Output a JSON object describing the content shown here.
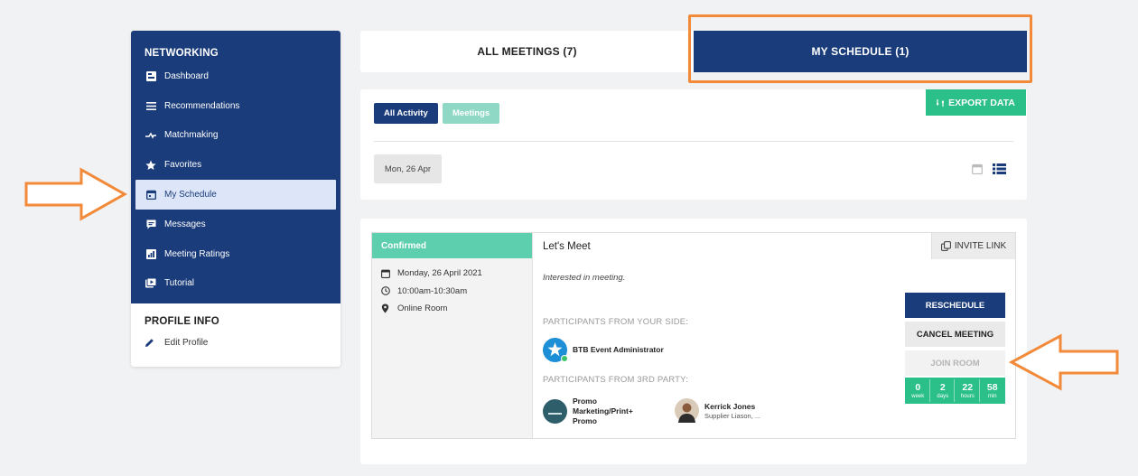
{
  "sidebar": {
    "title": "NETWORKING",
    "items": [
      {
        "label": "Dashboard",
        "icon": "dashboard-icon"
      },
      {
        "label": "Recommendations",
        "icon": "list-icon"
      },
      {
        "label": "Matchmaking",
        "icon": "handshake-icon"
      },
      {
        "label": "Favorites",
        "icon": "star-icon"
      },
      {
        "label": "My Schedule",
        "icon": "calendar-icon",
        "active": true
      },
      {
        "label": "Messages",
        "icon": "message-icon"
      },
      {
        "label": "Meeting Ratings",
        "icon": "rating-icon"
      },
      {
        "label": "Tutorial",
        "icon": "video-icon"
      }
    ],
    "profile_title": "PROFILE INFO",
    "edit_profile": "Edit Profile"
  },
  "tabs": {
    "all": "ALL MEETINGS (7)",
    "mine": "MY SCHEDULE (1)"
  },
  "filters": {
    "all_activity": "All Activity",
    "meetings": "Meetings",
    "export": "EXPORT DATA",
    "date": "Mon, 26 Apr"
  },
  "meeting": {
    "status": "Confirmed",
    "date": "Monday, 26 April 2021",
    "time": "10:00am-10:30am",
    "location": "Online Room",
    "title": "Let's Meet",
    "invite": "INVITE LINK",
    "description": "Interested in meeting.",
    "your_side_label": "PARTICIPANTS FROM YOUR SIDE:",
    "third_party_label": "PARTICIPANTS FROM 3RD PARTY:",
    "admin_name": "BTB Event Administrator",
    "promo_line1": "Promo",
    "promo_line2": "Marketing/Print+",
    "promo_line3": "Promo",
    "kerrick_name": "Kerrick Jones",
    "kerrick_role": "Supplier Liason, ...",
    "reschedule": "RESCHEDULE",
    "cancel": "CANCEL MEETING",
    "join": "JOIN ROOM",
    "countdown": [
      {
        "value": "0",
        "label": "week"
      },
      {
        "value": "2",
        "label": "days"
      },
      {
        "value": "22",
        "label": "hours"
      },
      {
        "value": "58",
        "label": "min"
      }
    ]
  },
  "colors": {
    "navy": "#1b3c7a",
    "green": "#2bbf8a",
    "teal": "#5dceae",
    "annotation_orange": "#f28a3a"
  }
}
